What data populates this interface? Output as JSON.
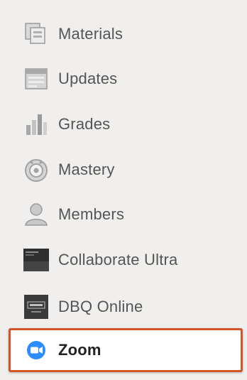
{
  "nav": {
    "items": [
      {
        "label": "Materials",
        "icon": "materials-icon"
      },
      {
        "label": "Updates",
        "icon": "updates-icon"
      },
      {
        "label": "Grades",
        "icon": "grades-icon"
      },
      {
        "label": "Mastery",
        "icon": "mastery-icon"
      },
      {
        "label": "Members",
        "icon": "members-icon"
      },
      {
        "label": "Collaborate Ultra",
        "icon": "collaborate-ultra-icon"
      },
      {
        "label": "DBQ Online",
        "icon": "dbq-online-icon"
      },
      {
        "label": "Zoom",
        "icon": "zoom-icon",
        "active": true
      }
    ]
  },
  "colors": {
    "background": "#f0efed",
    "highlight_border": "#d4542a",
    "zoom_blue": "#2d8cff"
  }
}
